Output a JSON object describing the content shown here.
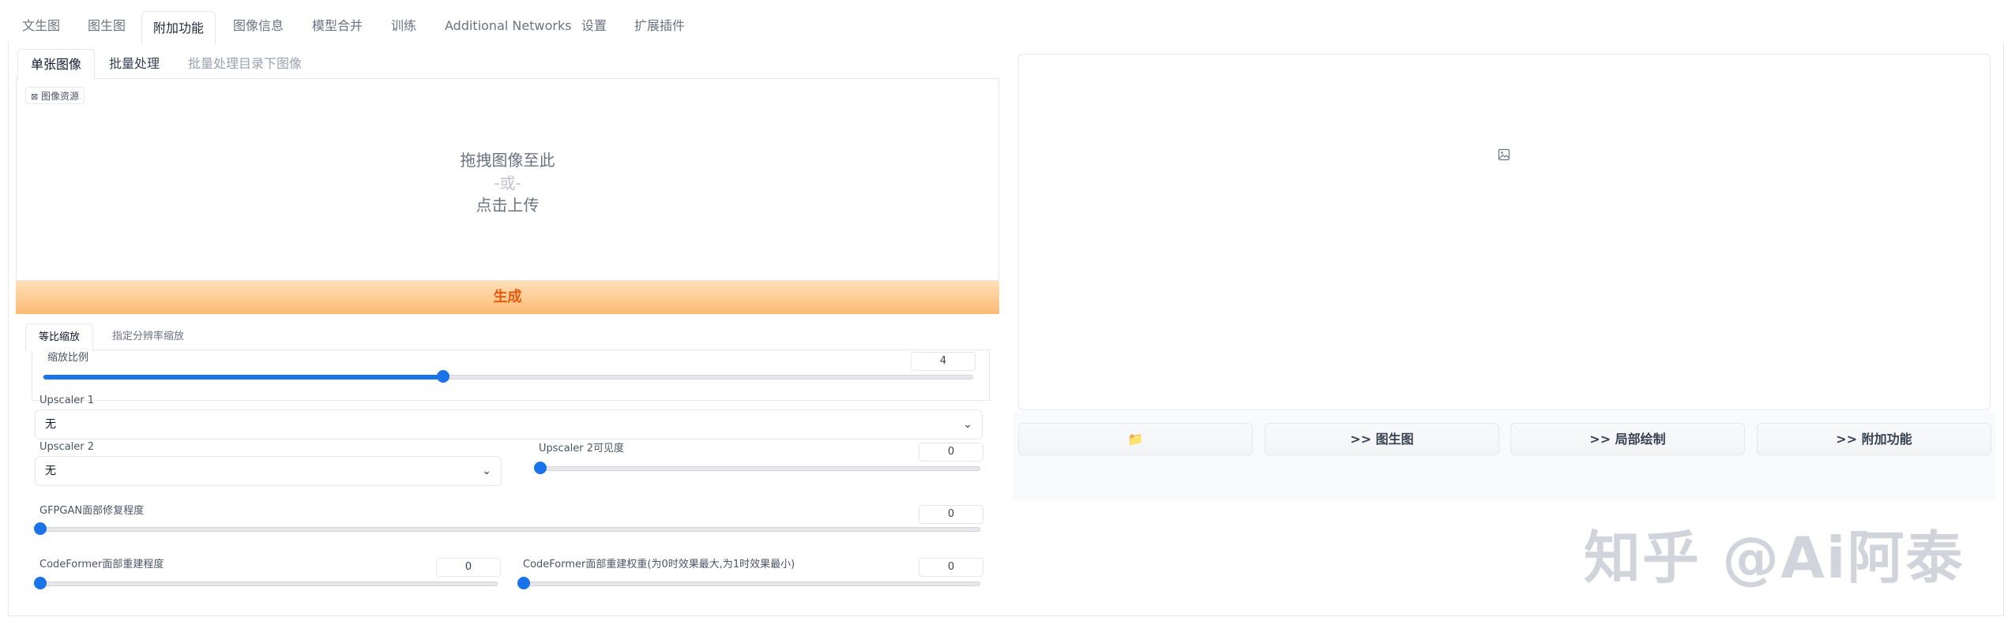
{
  "top_tabs": [
    "文生图",
    "图生图",
    "附加功能",
    "图像信息",
    "模型合并",
    "训练",
    "Additional Networks",
    "设置",
    "扩展插件"
  ],
  "sub_tabs": [
    "单张图像",
    "批量处理",
    "批量处理目录下图像"
  ],
  "upload": {
    "chip": "图像资源",
    "line1": "拖拽图像至此",
    "line2": "-或-",
    "line3": "点击上传"
  },
  "generate_label": "生成",
  "resize_tabs": [
    "等比缩放",
    "指定分辨率缩放"
  ],
  "scale": {
    "label": "缩放比例",
    "value": "4",
    "fraction": 0.43
  },
  "upscaler1": {
    "label": "Upscaler 1",
    "value": "无"
  },
  "upscaler2": {
    "label": "Upscaler 2",
    "value": "无"
  },
  "upscaler2_visibility": {
    "label": "Upscaler 2可见度",
    "value": "0",
    "fraction": 0
  },
  "gfpgan": {
    "label": "GFPGAN面部修复程度",
    "value": "0",
    "fraction": 0
  },
  "codeformer_visibility": {
    "label": "CodeFormer面部重建程度",
    "value": "0",
    "fraction": 0
  },
  "codeformer_weight": {
    "label": "CodeFormer面部重建权重(为0时效果最大,为1时效果最小)",
    "value": "0",
    "fraction": 0
  },
  "actions": [
    "📁",
    ">> 图生图",
    ">> 局部绘制",
    ">> 附加功能"
  ],
  "watermark": "知乎 @Ai阿泰",
  "accent": "#1a73e8"
}
